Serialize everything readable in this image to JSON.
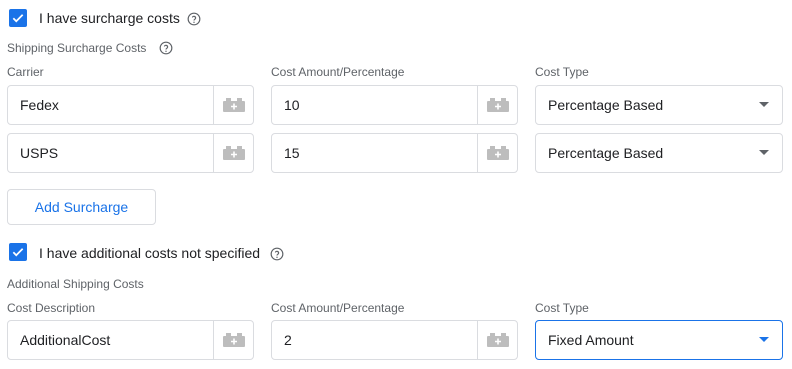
{
  "surcharge": {
    "checkbox_label": "I have surcharge costs",
    "checked": true,
    "section_title": "Shipping Surcharge Costs",
    "columns": {
      "carrier": "Carrier",
      "amount": "Cost Amount/Percentage",
      "type": "Cost Type"
    },
    "rows": [
      {
        "carrier": "Fedex",
        "amount": "10",
        "type": "Percentage Based"
      },
      {
        "carrier": "USPS",
        "amount": "15",
        "type": "Percentage Based"
      }
    ],
    "add_button_label": "Add Surcharge"
  },
  "additional": {
    "checkbox_label": "I have additional costs not specified",
    "checked": true,
    "section_title": "Additional Shipping Costs",
    "columns": {
      "description": "Cost Description",
      "amount": "Cost Amount/Percentage",
      "type": "Cost Type"
    },
    "rows": [
      {
        "description": "AdditionalCost",
        "amount": "2",
        "type": "Fixed Amount"
      }
    ]
  },
  "icons": {
    "checkbox": "check-icon",
    "help": "help-circle-icon",
    "field_addon": "lego-brick-icon",
    "select": "caret-down-icon"
  },
  "colors": {
    "accent": "#1a73e8",
    "border": "#dadce0",
    "label": "#5f6368",
    "text": "#202124",
    "addon_icon": "#bdbdbd"
  }
}
